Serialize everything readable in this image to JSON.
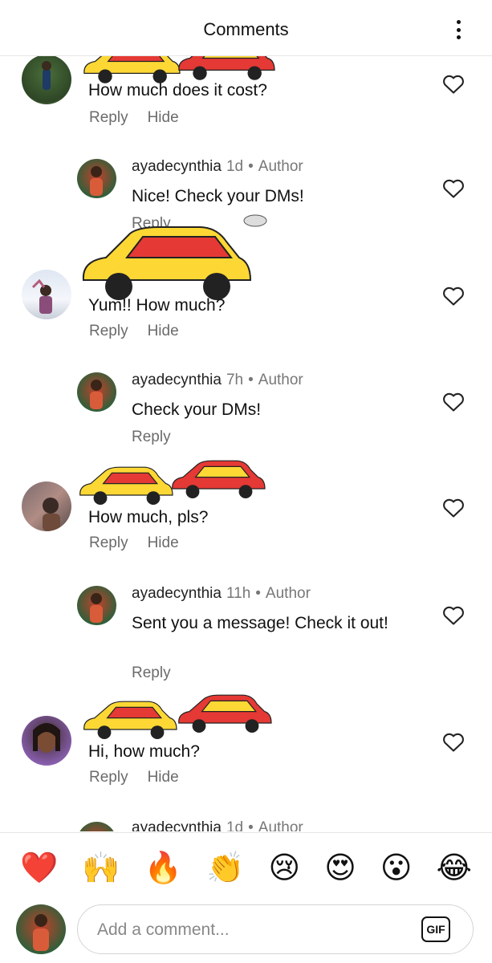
{
  "header": {
    "title": "Comments",
    "more_icon": "more-vertical-icon"
  },
  "comments": [
    {
      "avatar": "avatar-man-in-garden",
      "user": "",
      "text": "How much does it cost?",
      "reply_label": "Reply",
      "hide_label": "Hide"
    },
    {
      "avatar": "avatar-ayadecynthia",
      "user": "ayadecynthia",
      "time": "1d",
      "tag": "Author",
      "text": "Nice! Check your DMs!",
      "reply_label": "Reply"
    },
    {
      "avatar": "avatar-group-photo",
      "user": "",
      "text": "Yum!! How much?",
      "reply_label": "Reply",
      "hide_label": "Hide"
    },
    {
      "avatar": "avatar-ayadecynthia",
      "user": "ayadecynthia",
      "time": "7h",
      "tag": "Author",
      "text": "Check your DMs!",
      "reply_label": "Reply"
    },
    {
      "avatar": "avatar-woman-brown",
      "user": "",
      "text": "How much, pls?",
      "reply_label": "Reply",
      "hide_label": "Hide"
    },
    {
      "avatar": "avatar-ayadecynthia",
      "user": "ayadecynthia",
      "time": "11h",
      "tag": "Author",
      "text": "Sent you a message! Check it out!",
      "reply_label": "Reply"
    },
    {
      "avatar": "avatar-woman-smiling",
      "user": "",
      "text": "Hi, how much?",
      "reply_label": "Reply",
      "hide_label": "Hide"
    },
    {
      "avatar": "avatar-ayadecynthia",
      "user": "ayadecynthia",
      "time": "1d",
      "tag": "Author",
      "text": "",
      "reply_label": ""
    }
  ],
  "reactions": [
    "❤️",
    "🙌",
    "🔥",
    "👏",
    "😢",
    "😍",
    "😮",
    "😂"
  ],
  "composer": {
    "placeholder": "Add a comment...",
    "gif_label": "GIF"
  },
  "colors": {
    "car_body_red": "#e53935",
    "car_body_yellow": "#fdd835",
    "heart_outline": "#222222",
    "secondary_text": "#6b6b6b"
  }
}
